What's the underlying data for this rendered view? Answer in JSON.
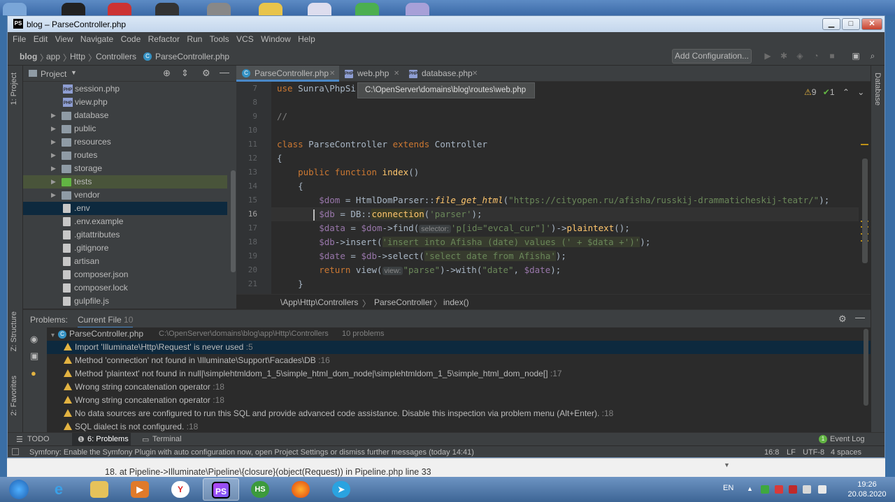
{
  "window": {
    "title": "blog – ParseController.php",
    "icon": "PS"
  },
  "menu": [
    "File",
    "Edit",
    "View",
    "Navigate",
    "Code",
    "Refactor",
    "Run",
    "Tools",
    "VCS",
    "Window",
    "Help"
  ],
  "breadcrumbs": [
    "blog",
    "app",
    "Http",
    "Controllers",
    "ParseController.php"
  ],
  "toolbar": {
    "add_configuration": "Add Configuration..."
  },
  "left_tabs": {
    "project": "1: Project",
    "structure": "Z: Structure",
    "favorites": "2: Favorites"
  },
  "right_tabs": {
    "database": "Database"
  },
  "project": {
    "title": "Project",
    "items": [
      {
        "label": "session.php",
        "type": "php"
      },
      {
        "label": "view.php",
        "type": "php"
      },
      {
        "label": "database",
        "type": "folder"
      },
      {
        "label": "public",
        "type": "folder"
      },
      {
        "label": "resources",
        "type": "folder"
      },
      {
        "label": "routes",
        "type": "folder"
      },
      {
        "label": "storage",
        "type": "folder"
      },
      {
        "label": "tests",
        "type": "folder-green"
      },
      {
        "label": "vendor",
        "type": "folder"
      },
      {
        "label": ".env",
        "type": "file"
      },
      {
        "label": ".env.example",
        "type": "file"
      },
      {
        "label": ".gitattributes",
        "type": "file"
      },
      {
        "label": ".gitignore",
        "type": "file"
      },
      {
        "label": "artisan",
        "type": "file"
      },
      {
        "label": "composer.json",
        "type": "file"
      },
      {
        "label": "composer.lock",
        "type": "file"
      },
      {
        "label": "gulpfile.js",
        "type": "file"
      }
    ]
  },
  "editor_tabs": [
    {
      "label": "ParseController.php",
      "icon": "C"
    },
    {
      "label": "web.php",
      "icon": "php"
    },
    {
      "label": "database.php",
      "icon": "php"
    }
  ],
  "tooltip": "C:\\OpenServer\\domains\\blog\\routes\\web.php",
  "inspections": {
    "warnings": "9",
    "ok": "1"
  },
  "code": {
    "line_numbers": [
      "7",
      "8",
      "9",
      "10",
      "11",
      "12",
      "13",
      "14",
      "15",
      "16",
      "17",
      "18",
      "19",
      "20",
      "21"
    ],
    "l7_kw": "use",
    "l7_rest": " Sunra\\PhpSi",
    "l9": "//",
    "l11_class": "class",
    "l11_name": " ParseController ",
    "l11_extends": "extends",
    "l11_parent": " Controller",
    "l12": "{",
    "l13_public": "public",
    "l13_function": "function",
    "l13_name": "index",
    "l13_paren": "()",
    "l14": "{",
    "l15_var": "$dom",
    "l15_mid": " = HtmlDomParser::",
    "l15_fn": "file_get_html",
    "l15_str": "\"https://cityopen.ru/afisha/russkij-drammaticheskij-teatr/\"",
    "l16_var": "$db",
    "l16_mid": " = DB::",
    "l16_fn": "connection",
    "l16_str": "'parser'",
    "l17_var": "$data",
    "l17_a": " = ",
    "l17_var2": "$dom",
    "l17_b": "->find(",
    "l17_hint": "selector:",
    "l17_str": "'p[id=\"evcal_cur\"]'",
    "l17_c": ")->",
    "l17_fn": "plaintext",
    "l17_d": "();",
    "l18_var": "$db",
    "l18_a": "->insert(",
    "l18_sql": "'insert into Afisha (date) values (' + $data +')'",
    "l18_b": ");",
    "l19_var": "$date",
    "l19_a": " = ",
    "l19_var2": "$db",
    "l19_b": "->select(",
    "l19_sql": "'select date from Afisha'",
    "l19_c": ");",
    "l20_kw": "return",
    "l20_a": " view(",
    "l20_hint": "view:",
    "l20_str": "\"parse\"",
    "l20_b": ")->with(",
    "l20_str2": "\"date\"",
    "l20_c": ", ",
    "l20_var": "$date",
    "l20_d": ");",
    "l21": "}"
  },
  "editor_breadcrumb": [
    "\\App\\Http\\Controllers",
    "ParseController",
    "index()"
  ],
  "problems": {
    "label": "Problems:",
    "tab": "Current File",
    "count": "10",
    "file": "ParseController.php",
    "path": "C:\\OpenServer\\domains\\blog\\app\\Http\\Controllers",
    "path_count": "10 problems",
    "items": [
      {
        "text": "Import 'Illuminate\\Http\\Request' is never used",
        "line": ":5"
      },
      {
        "text": "Method 'connection' not found in \\Illuminate\\Support\\Facades\\DB",
        "line": ":16"
      },
      {
        "text": "Method 'plaintext' not found in null|\\simplehtmldom_1_5\\simple_html_dom_node|\\simplehtmldom_1_5\\simple_html_dom_node[]",
        "line": ":17"
      },
      {
        "text": "Wrong string concatenation operator",
        "line": ":18"
      },
      {
        "text": "Wrong string concatenation operator",
        "line": ":18"
      },
      {
        "text": "No data sources are configured to run this SQL and provide advanced code assistance. Disable this inspection via problem menu (Alt+Enter).",
        "line": ":18"
      },
      {
        "text": "SQL dialect is not configured.",
        "line": ":18"
      }
    ]
  },
  "bottom_tabs": {
    "todo": "TODO",
    "problems": "6: Problems",
    "terminal": "Terminal",
    "event_log": "Event Log",
    "event_count": "1"
  },
  "status": {
    "message": "Symfony: Enable the Symfony Plugin with auto configuration now, open Project Settings or dismiss further messages (today 14:41)",
    "position": "16:8",
    "line_sep": "LF",
    "encoding": "UTF-8",
    "indent": "4 spaces"
  },
  "browser_text": "18.  at Pipeline->Illuminate\\Pipeline\\{closure}(object(Request)) in Pipeline.php line 33",
  "taskbar": {
    "lang": "EN",
    "time": "19:26",
    "date": "20.08.2020",
    "ps": "PS",
    "hs": "HS"
  }
}
